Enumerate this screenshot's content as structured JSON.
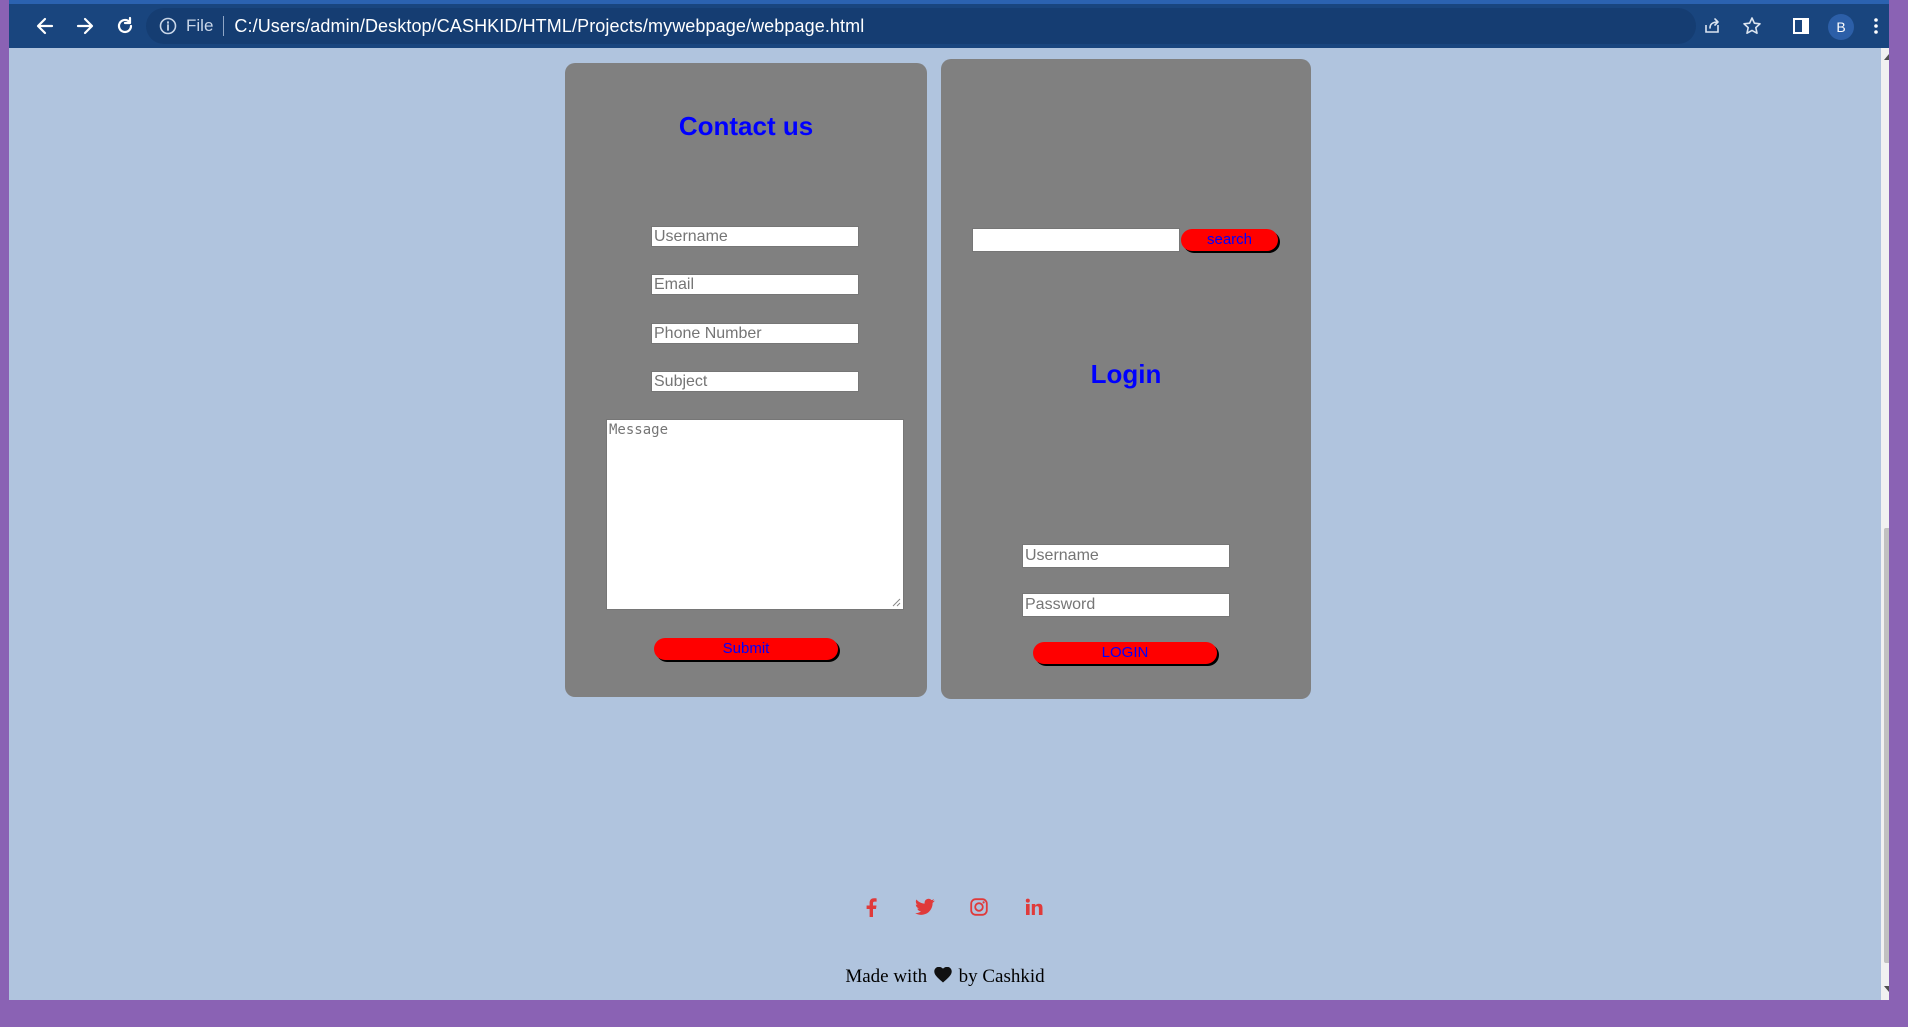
{
  "browser": {
    "file_label": "File",
    "url": "C:/Users/admin/Desktop/CASHKID/HTML/Projects/mywebpage/webpage.html",
    "profile_initial": "B"
  },
  "contact": {
    "title": "Contact us",
    "username_placeholder": "Username",
    "email_placeholder": "Email",
    "phone_placeholder": "Phone Number",
    "subject_placeholder": "Subject",
    "message_placeholder": "Message",
    "submit_label": "Submit"
  },
  "search": {
    "value": "",
    "button_label": "search"
  },
  "login": {
    "title": "Login",
    "username_placeholder": "Username",
    "password_placeholder": "Password",
    "button_label": "LOGIN"
  },
  "social": {
    "icons": [
      "facebook-icon",
      "twitter-icon",
      "instagram-icon",
      "linkedin-icon"
    ],
    "color": "#e03a3a"
  },
  "footer": {
    "text_before": "Made with",
    "text_after": "by Cashkid"
  },
  "colors": {
    "page_bg": "#b0c4de",
    "card_bg": "#808080",
    "title": "#0000ff",
    "button_bg": "#ff0000",
    "button_text": "#0000ff",
    "toolbar": "#19457e"
  }
}
